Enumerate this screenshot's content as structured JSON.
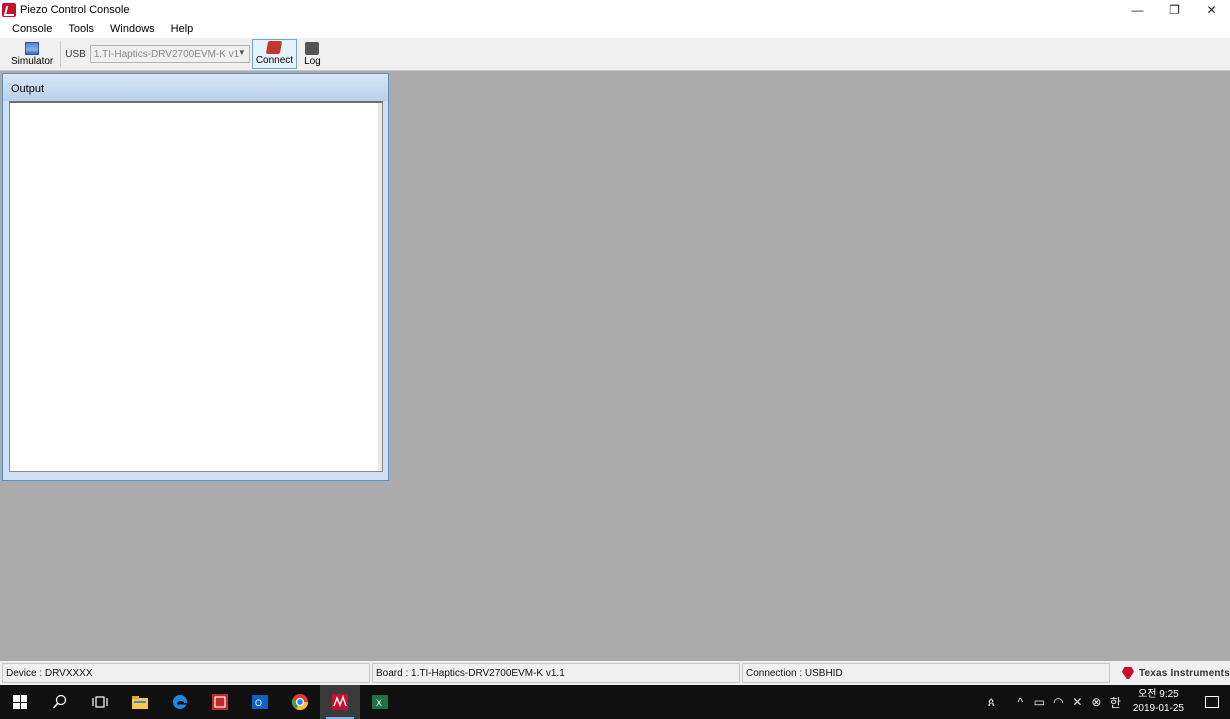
{
  "window": {
    "title": "Piezo Control Console",
    "controls": {
      "minimize": "—",
      "restore": "❐",
      "close": "✕"
    }
  },
  "menu": [
    "Console",
    "Tools",
    "Windows",
    "Help"
  ],
  "toolbar": {
    "simulator_label": "Simulator",
    "usb_label": "USB",
    "usb_selected": "1.TI-Haptics-DRV2700EVM-K v1",
    "connect_label": "Connect",
    "log_label": "Log"
  },
  "output_panel": {
    "title": "Output",
    "content": ""
  },
  "status": {
    "device": "Device : DRVXXXX",
    "board": "Board : 1.TI-Haptics-DRV2700EVM-K v1.1",
    "connection": "Connection : USBHID",
    "brand": "Texas Instruments"
  },
  "taskbar": {
    "apps": [
      "start-icon",
      "search-icon",
      "task-view-icon",
      "file-explorer-icon",
      "edge-icon",
      "app-red-icon",
      "outlook-icon",
      "chrome-icon",
      "piezo-console-icon",
      "excel-icon"
    ],
    "clock_time": "오전 9:25",
    "clock_date": "2019-01-25",
    "ime_indicator": "한"
  },
  "colors": {
    "workspace": "#ababab",
    "panel_border": "#5a8fc6",
    "brand_red": "#c8102e",
    "taskbar": "#101010"
  }
}
